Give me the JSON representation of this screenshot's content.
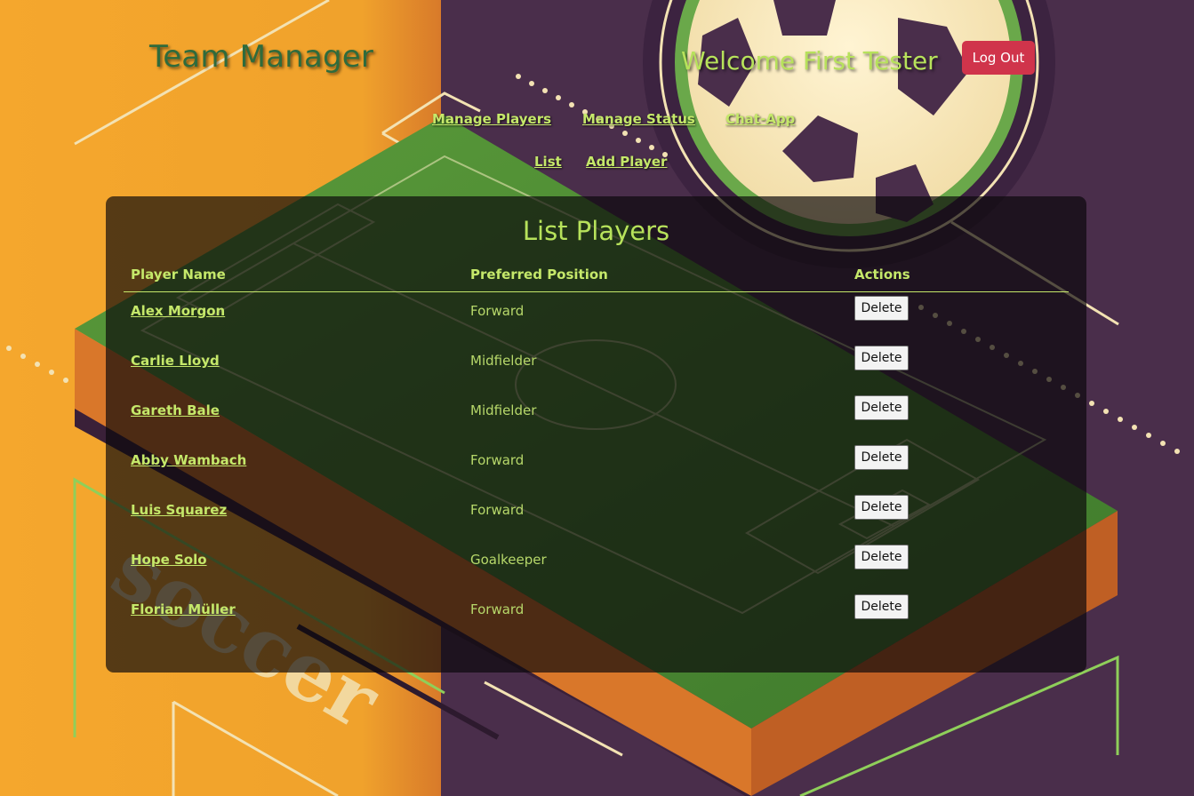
{
  "header": {
    "app_title": "Team Manager",
    "welcome_text": "Welcome First Tester",
    "logout_label": "Log Out"
  },
  "nav": {
    "row1": [
      "Manage Players",
      "Manage Status",
      "Chat-App"
    ],
    "row2": [
      "List",
      "Add Player"
    ]
  },
  "panel": {
    "title": "List Players",
    "columns": [
      "Player Name",
      "Preferred Position",
      "Actions"
    ],
    "rows": [
      {
        "name": "Alex Morgon",
        "position": "Forward",
        "action": "Delete"
      },
      {
        "name": "Carlie Lloyd",
        "position": "Midfielder",
        "action": "Delete"
      },
      {
        "name": "Gareth Bale",
        "position": "Midfielder",
        "action": "Delete"
      },
      {
        "name": "Abby Wambach",
        "position": "Forward",
        "action": "Delete"
      },
      {
        "name": "Luis Squarez",
        "position": "Forward",
        "action": "Delete"
      },
      {
        "name": "Hope Solo",
        "position": "Goalkeeper",
        "action": "Delete"
      },
      {
        "name": "Florian Müller",
        "position": "Forward",
        "action": "Delete"
      }
    ]
  },
  "background": {
    "watermark_text": "soccer"
  },
  "colors": {
    "accent_green": "#b7e25b",
    "title_green": "#2f6b3c",
    "logout_red": "#d0344b",
    "bg_orange": "#f4a72e",
    "bg_purple": "#4a2e4b"
  }
}
